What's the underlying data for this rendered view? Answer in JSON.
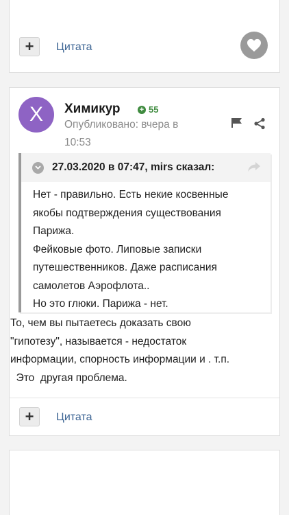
{
  "prev_post": {
    "plus_label": "+",
    "quote_label": "Цитата"
  },
  "post": {
    "avatar_letter": "Х",
    "author": "Химикур",
    "reputation": "55",
    "published_line1": "Опубликовано: вчера в",
    "published_line2": "10:53",
    "quote": {
      "header": "27.03.2020 в 07:47, mirs сказал:",
      "lines": [
        "Нет - правильно. Есть некие косвенные",
        "якобы подтверждения существования",
        "Парижа.",
        "Фейковые фото. Липовые записки",
        "путешественников. Даже расписания",
        "самолетов Аэрофлота..",
        "Но это глюки. Парижа - нет."
      ]
    },
    "body_lines": [
      "То, чем  вы пытаетесь доказать свою",
      "\"гипотезу\", называется - недостаток",
      "информации, спорность информации и . т.п.",
      "  Это  другая проблема."
    ],
    "plus_label": "+",
    "quote_label": "Цитата"
  },
  "colors": {
    "link": "#3d6594",
    "avatar": "#8e63c4",
    "reputation": "#3f8b3f"
  }
}
